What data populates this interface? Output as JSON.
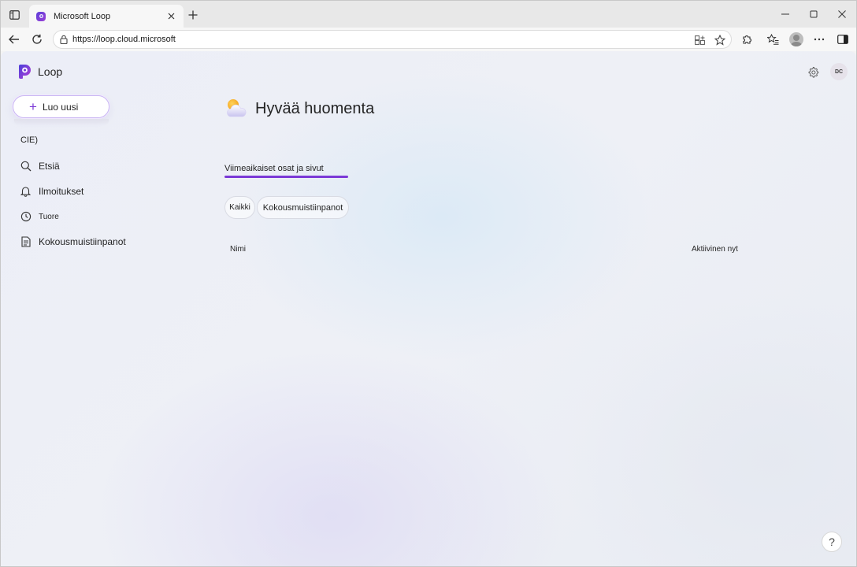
{
  "browser": {
    "tab_title": "Microsoft Loop",
    "url": "https://loop.cloud.microsoft"
  },
  "app": {
    "name": "Loop",
    "accent_color": "#7b39d6"
  },
  "sidebar": {
    "create_label": "Luo uusi",
    "workspace_label": "CIE)",
    "items": [
      {
        "label": "Etsiä",
        "icon": "search-icon"
      },
      {
        "label": "Ilmoitukset",
        "icon": "bell-icon"
      },
      {
        "label": "Tuore",
        "icon": "clock-icon"
      },
      {
        "label": "Kokousmuistiinpanot",
        "icon": "notes-icon"
      }
    ]
  },
  "header": {
    "user_initials": "DC"
  },
  "main": {
    "greeting": "Hyvää huomenta",
    "section_tab": "Viimeaikaiset osat ja sivut",
    "filters": [
      "Kaikki",
      "Kokousmuistiinpanot"
    ],
    "columns": [
      "Nimi",
      "Aktiivinen nyt"
    ]
  },
  "help_label": "?"
}
